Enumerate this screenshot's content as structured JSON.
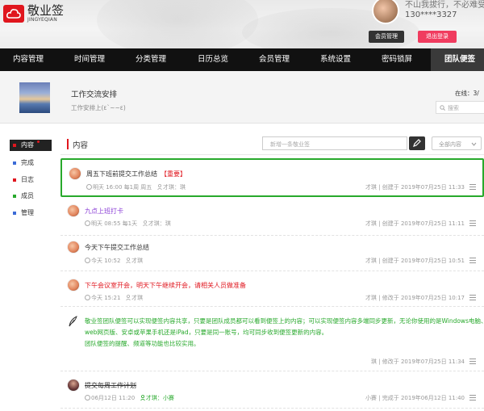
{
  "app": {
    "title": "敬业签",
    "subtitle": "JINGYEQIAN"
  },
  "user": {
    "motto": "不山我拔行，不必难受",
    "phone": "130****3327",
    "member_btn": "会员管理",
    "logout_btn": "退出登录"
  },
  "nav": [
    "内容管理",
    "时间管理",
    "分类管理",
    "日历总览",
    "会员管理",
    "系统设置",
    "密码锁屏",
    "团队便签"
  ],
  "team": {
    "name": "工作交流安排",
    "desc": "工作安排上(ε`~~ε)",
    "online": "在线：3/",
    "search_placeholder": "搜索"
  },
  "sidebar": [
    "内容",
    "完成",
    "日志",
    "成员",
    "管理"
  ],
  "sidebar_colors": [
    "#e0161e",
    "#3b6bd6",
    "#e0161e",
    "#28a92c",
    "#3b6bd6"
  ],
  "content": {
    "title": "内容",
    "new_placeholder": "新增一条敬业签",
    "filter": "全部内容"
  },
  "notes": [
    {
      "title": "周五下班前提交工作总结",
      "tag": "【重要】",
      "title_color": "#333333",
      "meta_time": "明天 16:00 每1周 周五",
      "meta_person_label": "才琪：",
      "meta_person": "琪",
      "right": "才琪 | 创建于 2019年07月25日 11:33"
    },
    {
      "title": "九点上班打卡",
      "title_color": "#8b3fd6",
      "meta_time": "明天 08:55 每1天",
      "meta_person_label": "才琪：",
      "meta_person": "琪",
      "right": "才琪 | 创建于 2019年07月25日 11:11"
    },
    {
      "title": "今天下午提交工作总结",
      "title_color": "#333333",
      "meta_time": "今天 10:52",
      "meta_person_label": "才琪",
      "meta_person": "",
      "right": "才琪 | 创建于 2019年07月25日 10:51"
    },
    {
      "title": "下午会议室开会，明天下午继续开会，请相关人员做准备",
      "title_color": "#e0161e",
      "meta_time": "今天 15:21",
      "meta_person_label": "才琪",
      "meta_person": "",
      "right": "才琪 | 修改于 2019年07月25日 10:17"
    },
    {
      "body": [
        "敬业签团队便签可以实现便签内容共享，只要是团队成员都可以看到便签上的内容；可以实现便签内容多端同步更新，无论你使用的是Windows电脑、",
        "web网页版、安卓或苹果手机还是iPad，只要是同一账号，均可同步收到便签更新的内容。",
        "团队便签的提醒、频道等功能也比较实用。"
      ],
      "right": "琪 | 修改于 2019年07月25日 11:34"
    },
    {
      "title": "提交每周工作计划",
      "title_color": "#333333",
      "strike": true,
      "meta_time": "06月12日 11:20",
      "meta_person_label": "才琪：",
      "meta_person": "小賽",
      "right": "小賽 | 完成于 2019年06月12日 11:40"
    }
  ]
}
